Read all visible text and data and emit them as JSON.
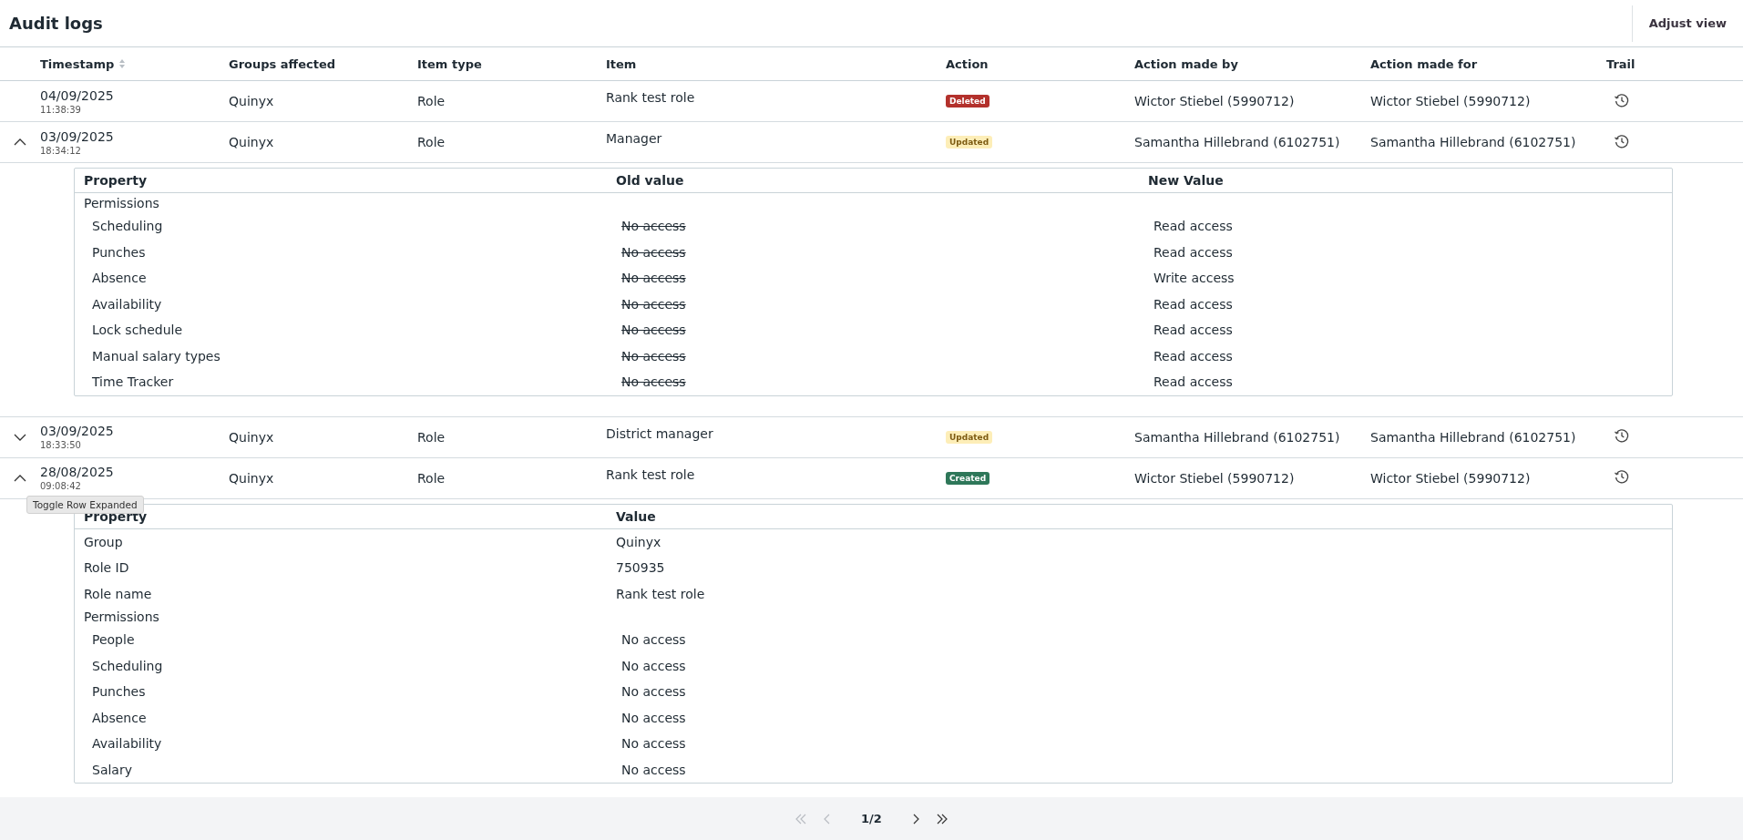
{
  "title": "Audit logs",
  "adjust_view": "Adjust view",
  "columns": [
    {
      "label": "Timestamp",
      "sortable": true
    },
    {
      "label": "Groups affected",
      "sortable": false
    },
    {
      "label": "Item type",
      "sortable": false
    },
    {
      "label": "Item",
      "sortable": false
    },
    {
      "label": "Action",
      "sortable": false
    },
    {
      "label": "Action made by",
      "sortable": false
    },
    {
      "label": "Action made for",
      "sortable": false
    },
    {
      "label": "Trail",
      "sortable": false
    }
  ],
  "rows": [
    {
      "expandable": false,
      "expanded": false,
      "date": "04/09/2025",
      "time": "11:38:39",
      "groups": "Quinyx",
      "item_type": "Role",
      "item": "Rank test role",
      "action": {
        "label": "Deleted",
        "kind": "deleted"
      },
      "made_by": "Wictor Stiebel (5990712)",
      "made_for": "Wictor Stiebel (5990712)"
    },
    {
      "expandable": true,
      "expanded": true,
      "date": "03/09/2025",
      "time": "18:34:12",
      "groups": "Quinyx",
      "item_type": "Role",
      "item": "Manager",
      "action": {
        "label": "Updated",
        "kind": "updated"
      },
      "made_by": "Samantha Hillebrand (6102751)",
      "made_for": "Samantha Hillebrand (6102751)",
      "details": {
        "kind": "change",
        "columns": [
          "Property",
          "Old value",
          "New Value"
        ],
        "rows": [
          {
            "property": "Permissions",
            "children": [
              {
                "property": "Scheduling",
                "values": [
                  "No access",
                  "Read access"
                ]
              },
              {
                "property": "Punches",
                "values": [
                  "No access",
                  "Read access"
                ]
              },
              {
                "property": "Absence",
                "values": [
                  "No access",
                  "Write access"
                ]
              },
              {
                "property": "Availability",
                "values": [
                  "No access",
                  "Read access"
                ]
              },
              {
                "property": "Lock schedule",
                "values": [
                  "No access",
                  "Read access"
                ]
              },
              {
                "property": "Manual salary types",
                "values": [
                  "No access",
                  "Read access"
                ]
              },
              {
                "property": "Time Tracker",
                "values": [
                  "No access",
                  "Read access"
                ]
              }
            ]
          }
        ]
      }
    },
    {
      "expandable": true,
      "expanded": false,
      "date": "03/09/2025",
      "time": "18:33:50",
      "groups": "Quinyx",
      "item_type": "Role",
      "item": "District manager",
      "action": {
        "label": "Updated",
        "kind": "updated"
      },
      "made_by": "Samantha Hillebrand (6102751)",
      "made_for": "Samantha Hillebrand (6102751)"
    },
    {
      "expandable": true,
      "expanded": true,
      "tooltip": "Toggle Row Expanded",
      "date": "28/08/2025",
      "time": "09:08:42",
      "groups": "Quinyx",
      "item_type": "Role",
      "item": "Rank test role",
      "action": {
        "label": "Created",
        "kind": "created"
      },
      "made_by": "Wictor Stiebel (5990712)",
      "made_for": "Wictor Stiebel (5990712)",
      "details": {
        "kind": "created",
        "columns": [
          "Property",
          "Value"
        ],
        "rows": [
          {
            "property": "Group",
            "values": [
              "Quinyx"
            ]
          },
          {
            "property": "Role ID",
            "values": [
              "750935"
            ]
          },
          {
            "property": "Role name",
            "values": [
              "Rank test role"
            ]
          },
          {
            "property": "Permissions",
            "children": [
              {
                "property": "People",
                "values": [
                  "No access"
                ]
              },
              {
                "property": "Scheduling",
                "values": [
                  "No access"
                ]
              },
              {
                "property": "Punches",
                "values": [
                  "No access"
                ]
              },
              {
                "property": "Absence",
                "values": [
                  "No access"
                ]
              },
              {
                "property": "Availability",
                "values": [
                  "No access"
                ]
              },
              {
                "property": "Salary",
                "values": [
                  "No access"
                ]
              }
            ]
          }
        ]
      }
    }
  ],
  "pagination": {
    "page": "1/2",
    "buttons": [
      {
        "kind": "first",
        "disabled": true
      },
      {
        "kind": "prev",
        "disabled": true
      },
      {
        "kind": "next",
        "disabled": false
      },
      {
        "kind": "last",
        "disabled": false
      }
    ]
  }
}
